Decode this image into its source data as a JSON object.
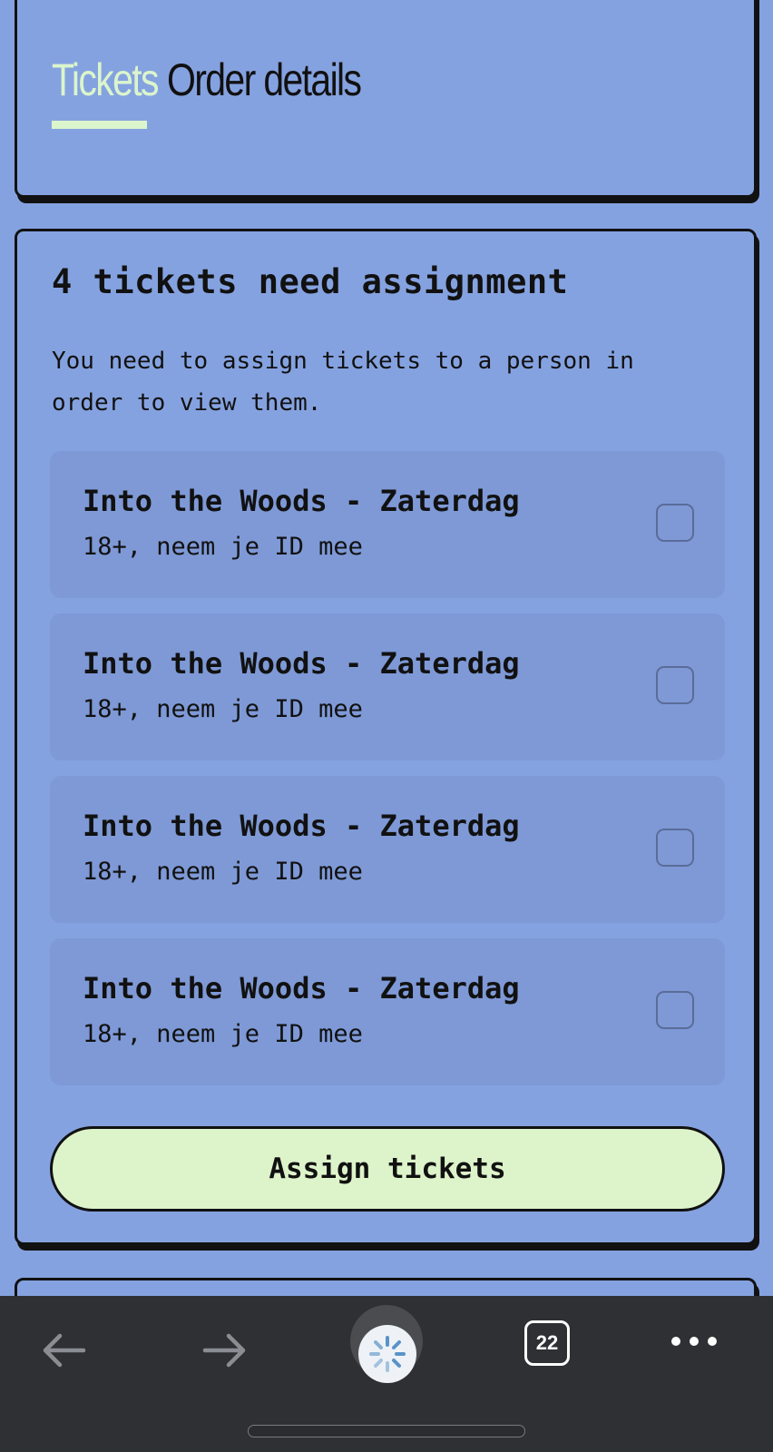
{
  "tabs": {
    "tickets_label": "Tickets",
    "order_details_label": "Order details"
  },
  "assignment": {
    "heading": "4 tickets need assignment",
    "description": "You need to assign tickets to a person in order to view them.",
    "tickets": [
      {
        "title": "Into the Woods - Zaterdag",
        "subtitle": "18+, neem je ID mee",
        "checked": false
      },
      {
        "title": "Into the Woods - Zaterdag",
        "subtitle": "18+, neem je ID mee",
        "checked": false
      },
      {
        "title": "Into the Woods - Zaterdag",
        "subtitle": "18+, neem je ID mee",
        "checked": false
      },
      {
        "title": "Into the Woods - Zaterdag",
        "subtitle": "18+, neem je ID mee",
        "checked": false
      }
    ],
    "assign_button_label": "Assign tickets"
  },
  "browser_toolbar": {
    "back_icon": "arrow-left-icon",
    "forward_icon": "arrow-right-icon",
    "loading_icon": "spinner-icon",
    "tab_count": "22",
    "more_icon": "ellipsis-icon"
  },
  "colors": {
    "page_background": "#85a2e0",
    "ticket_background": "#7e99d6",
    "accent_green": "#ddf3ca",
    "toolbar_background": "#2e3033"
  }
}
